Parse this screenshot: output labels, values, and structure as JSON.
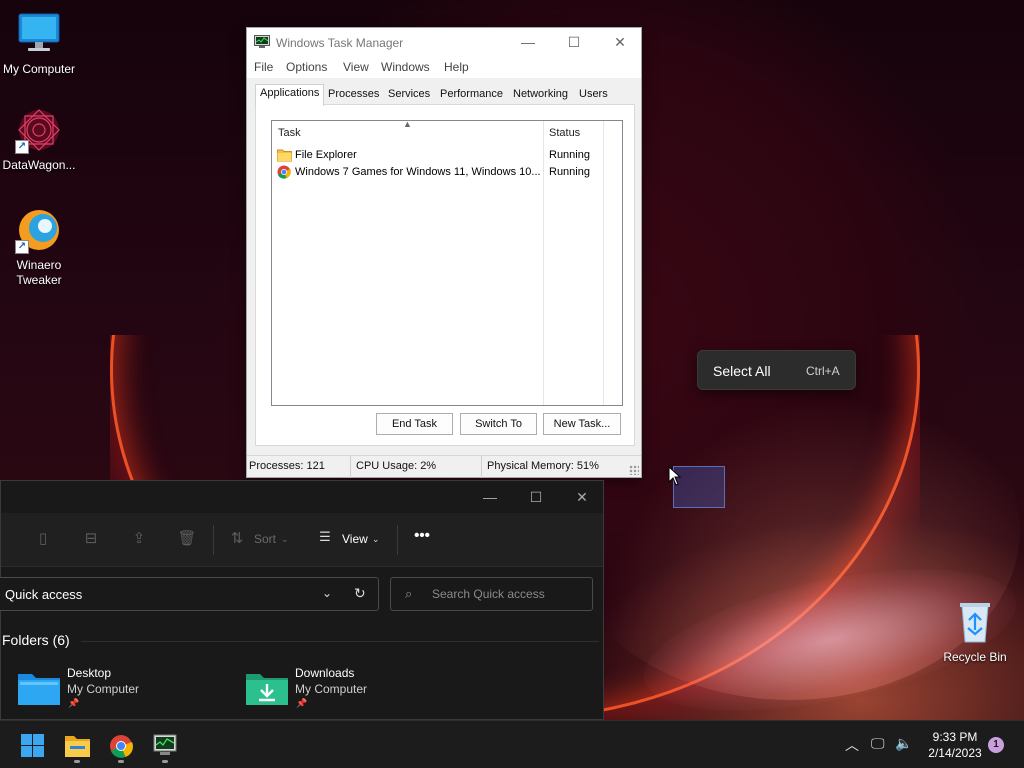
{
  "desktop": {
    "icons": [
      {
        "label": "My Computer",
        "icon": "monitor-icon"
      },
      {
        "label": "DataWagon...",
        "icon": "datawagon-icon"
      },
      {
        "label": "Winaero Tweaker",
        "icon": "winaero-icon"
      },
      {
        "label": "Recycle Bin",
        "icon": "recycle-bin-icon"
      }
    ]
  },
  "task_manager": {
    "title": "Windows Task Manager",
    "menu": [
      "File",
      "Options",
      "View",
      "Windows",
      "Help"
    ],
    "tabs": [
      "Applications",
      "Processes",
      "Services",
      "Performance",
      "Networking",
      "Users"
    ],
    "active_tab": "Applications",
    "columns": {
      "task": "Task",
      "status": "Status"
    },
    "rows": [
      {
        "task": "File Explorer",
        "status": "Running",
        "icon": "folder-icon"
      },
      {
        "task": "Windows 7 Games for Windows 11, Windows 10...",
        "status": "Running",
        "icon": "chrome-icon"
      }
    ],
    "buttons": {
      "end_task": "End Task",
      "switch_to": "Switch To",
      "new_task": "New Task..."
    },
    "status_bar": {
      "processes": "Processes: 121",
      "cpu": "CPU Usage: 2%",
      "memory": "Physical Memory: 51%"
    }
  },
  "context_menu": {
    "label": "Select All",
    "shortcut": "Ctrl+A"
  },
  "file_explorer": {
    "toolbar": {
      "sort": "Sort",
      "view": "View"
    },
    "address": "Quick access",
    "search_placeholder": "Search Quick access",
    "section_title": "Folders (6)",
    "folders": [
      {
        "name": "Desktop",
        "location": "My Computer"
      },
      {
        "name": "Downloads",
        "location": "My Computer"
      }
    ]
  },
  "taskbar": {
    "time": "9:33 PM",
    "date": "2/14/2023",
    "notification_count": "1"
  },
  "colors": {
    "accent": "#0078d4",
    "explorer_bg": "#191919",
    "taskbar_bg": "#1c1c1c"
  }
}
